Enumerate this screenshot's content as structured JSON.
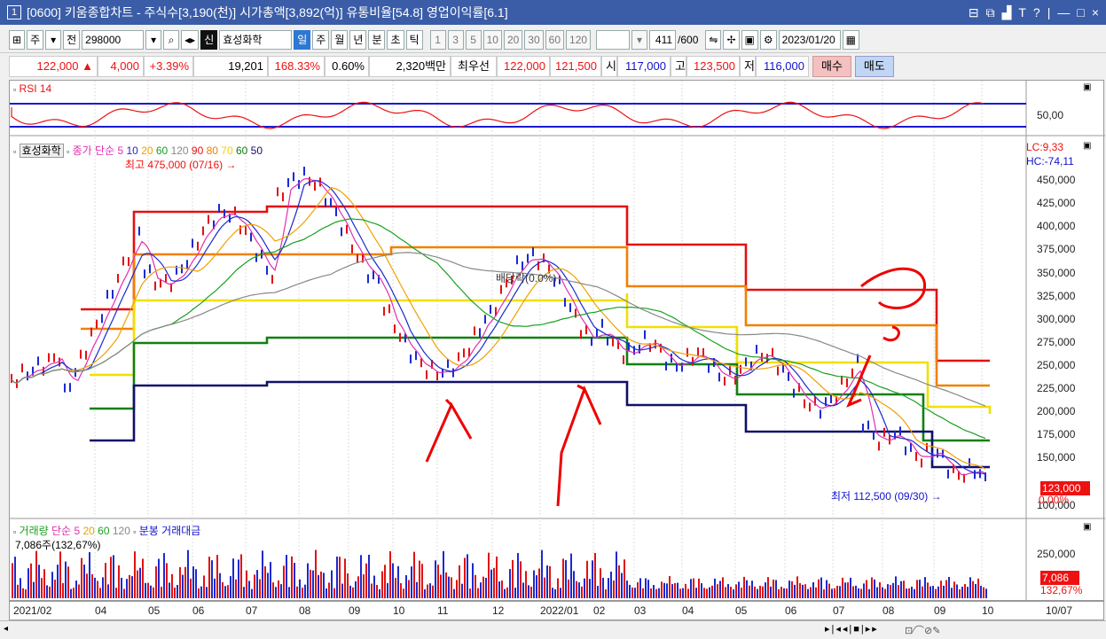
{
  "window": {
    "num": "1",
    "title": "[0600] 키움종합차트 - 주식수[3,190(천)] 시가총액[3,892(억)] 유통비율[54.8] 영업이익률[6.1]",
    "controls": [
      "⊟",
      "⧉",
      "▟",
      "T",
      "?",
      "|",
      "—",
      "□",
      "×"
    ]
  },
  "toolbar": {
    "period_sel": "주",
    "period_prefix": "전",
    "code": "298000",
    "new_label": "신",
    "stock_name": "효성화학",
    "tabs": [
      "일",
      "주",
      "월",
      "년",
      "분",
      "초",
      "틱"
    ],
    "active_tab": "일",
    "numbers": [
      "1",
      "3",
      "5",
      "10",
      "20",
      "30",
      "60",
      "120"
    ],
    "count": "411",
    "total": "/600",
    "date": "2023/01/20"
  },
  "quote": {
    "price": "122,000 ▲",
    "change": "4,000",
    "rate": "+3.39%",
    "volume": "19,201",
    "vol_ratio": "168.33%",
    "turnover": "0.60%",
    "amount": "2,320백만",
    "best_label": "최우선",
    "ask": "122,000",
    "bid": "121,500",
    "open_label": "시",
    "open": "117,000",
    "high_label": "고",
    "high": "123,500",
    "low_label": "저",
    "low": "116,000",
    "buy": "매수",
    "sell": "매도"
  },
  "rsi": {
    "title": "RSI 14",
    "level": "50,00",
    "color": "#e11"
  },
  "price_legend": {
    "name": "효성화학",
    "close_label": "종가",
    "ma_label": "단순",
    "ma": [
      {
        "v": "5",
        "c": "#e02fb0"
      },
      {
        "v": "10",
        "c": "#1a2ad0"
      },
      {
        "v": "20",
        "c": "#f0a000"
      },
      {
        "v": "60",
        "c": "#1aa020"
      },
      {
        "v": "120",
        "c": "#888888"
      },
      {
        "v": "90",
        "c": "#e11111"
      },
      {
        "v": "80",
        "c": "#f08000"
      },
      {
        "v": "70",
        "c": "#f0d000"
      },
      {
        "v": "60",
        "c": "#118011"
      },
      {
        "v": "50",
        "c": "#10106a"
      }
    ],
    "high_note": "최고 475,000 (07/16) →",
    "low_note": "최저 112,500 (09/30) →",
    "dividend_note": "배당락(0.0%)",
    "lc": "LC:9,33",
    "hc": "HC:-74,11",
    "last_price": "123,000",
    "last_rate": "0.00%"
  },
  "y_labels": [
    "450,000",
    "425,000",
    "400,000",
    "375,000",
    "350,000",
    "325,000",
    "300,000",
    "275,000",
    "250,000",
    "225,000",
    "200,000",
    "175,000",
    "150,000",
    "100,000"
  ],
  "volume_legend": {
    "title": "거래량",
    "ma_label": "단순",
    "ma": [
      {
        "v": "5",
        "c": "#e02fb0"
      },
      {
        "v": "20",
        "c": "#f0a000"
      },
      {
        "v": "60",
        "c": "#1aa020"
      },
      {
        "v": "120",
        "c": "#888888"
      }
    ],
    "extra": "분봉 거래대금",
    "current": "7,086주(132,67%)",
    "axis_label": "250,000",
    "last_vol": "7,086",
    "last_ratio": "132,67%"
  },
  "x_labels": [
    "2021/02",
    "04",
    "05",
    "06",
    "07",
    "08",
    "09",
    "10",
    "11",
    "12",
    "2022/01",
    "02",
    "03",
    "04",
    "05",
    "06",
    "07",
    "08",
    "09",
    "10",
    "10/07"
  ],
  "colors": {
    "up": "#e11111",
    "down": "#1a2ad0",
    "accent": "#3b5da8"
  }
}
